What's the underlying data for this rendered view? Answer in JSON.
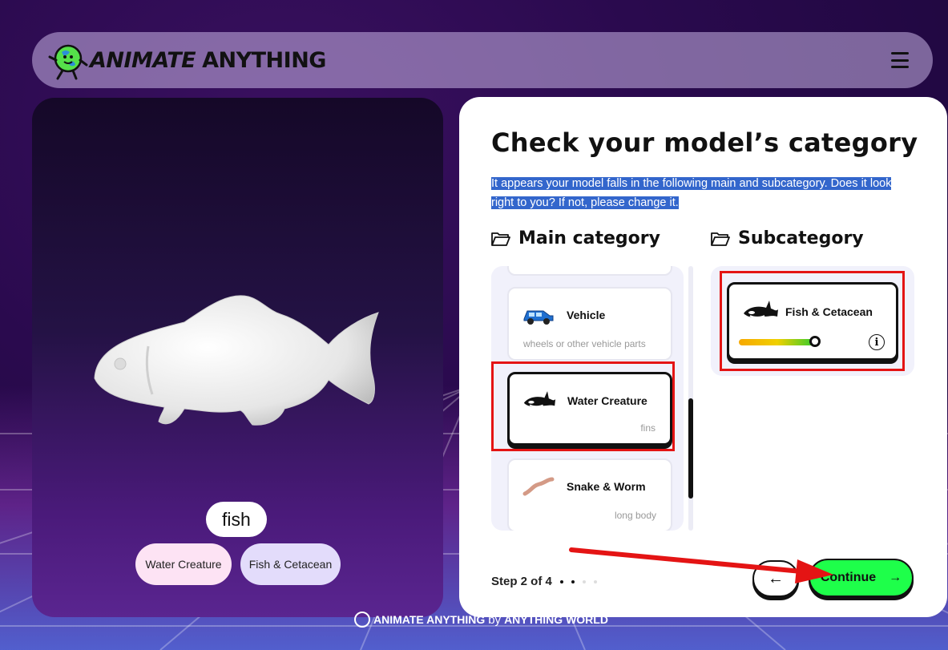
{
  "app": {
    "logo_word1": "ANIMATE",
    "logo_word2": "ANYTHING"
  },
  "preview": {
    "model_name": "fish",
    "tags": [
      "Water Creature",
      "Fish & Cetacean"
    ]
  },
  "footer": {
    "brand_left": "ANIMATE ANYTHING",
    "by": "by",
    "brand_right": "ANYTHING WORLD"
  },
  "card": {
    "title": "Check your model’s category",
    "description": "It appears your model falls in the following main and subcategory. Does it look right to you? If not, please change it.",
    "main_heading": "Main category",
    "sub_heading": "Subcategory",
    "main_items": [
      {
        "name": "Vehicle",
        "hint": "wheels or other vehicle parts"
      },
      {
        "name": "Water Creature",
        "hint": "fins"
      },
      {
        "name": "Snake & Worm",
        "hint": "long body"
      }
    ],
    "sub_items": [
      {
        "name": "Fish & Cetacean",
        "confidence": 0.88
      }
    ],
    "info_glyph": "i",
    "step_label": "Step 2 of 4",
    "step_current": 2,
    "step_total": 4,
    "back_glyph": "←",
    "continue_label": "Continue",
    "continue_glyph": "→"
  },
  "colors": {
    "accent_green": "#1eff4a",
    "highlight_blue": "#3366cc",
    "annotation_red": "#e41414"
  }
}
